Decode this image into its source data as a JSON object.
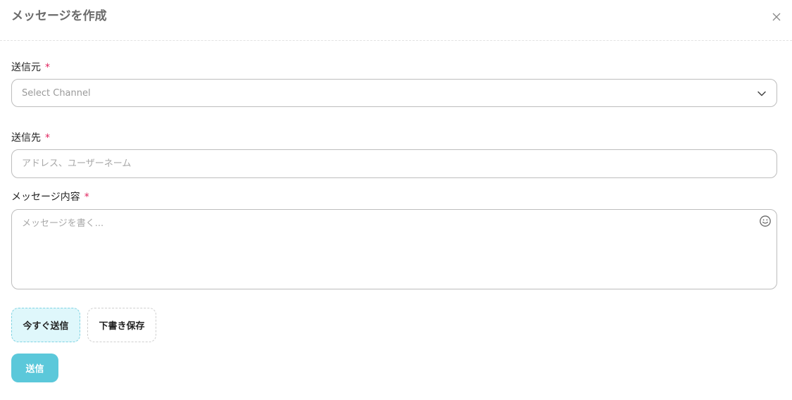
{
  "header": {
    "title": "メッセージを作成",
    "close_icon": "close-icon"
  },
  "from_field": {
    "label": "送信元",
    "required_mark": "*",
    "placeholder": "Select Channel",
    "icon": "chevron-down-icon"
  },
  "to_field": {
    "label": "送信先",
    "required_mark": "*",
    "placeholder": "アドレス、ユーザーネーム",
    "value": ""
  },
  "message_field": {
    "label": "メッセージ内容",
    "required_mark": "*",
    "placeholder": "メッセージを書く...",
    "value": "",
    "icon": "emoji-icon"
  },
  "options": {
    "send_now_label": "今すぐ送信",
    "save_draft_label": "下書き保存",
    "selected": "send_now"
  },
  "submit": {
    "label": "送信"
  },
  "colors": {
    "accent": "#5bc8da",
    "selected_bg": "#dff7fb",
    "required": "#e0245e"
  }
}
